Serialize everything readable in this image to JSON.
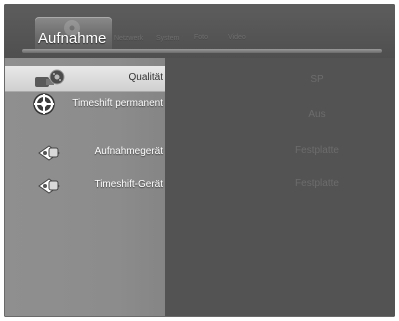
{
  "tabs": {
    "active": "Aufnahme",
    "others": [
      "Netzwerk",
      "System",
      "Foto",
      "Video"
    ]
  },
  "settings": [
    {
      "label": "Qualität",
      "value": "SP",
      "icon": "film-camera-icon",
      "selected": true
    },
    {
      "label": "Timeshift permanent",
      "value": "Aus",
      "icon": "timeshift-clock-icon",
      "selected": false
    },
    {
      "label": "Aufnahmegerät",
      "value": "Festplatte",
      "icon": "recording-device-icon",
      "selected": false
    },
    {
      "label": "Timeshift-Gerät",
      "value": "Festplatte",
      "icon": "timeshift-device-icon",
      "selected": false
    }
  ],
  "colors": {
    "frame_bg": "#4a4a4a",
    "left_pane": "#8c8c8c",
    "selected_row": "#dcdcdc",
    "value_text": "#6c6c6c"
  }
}
